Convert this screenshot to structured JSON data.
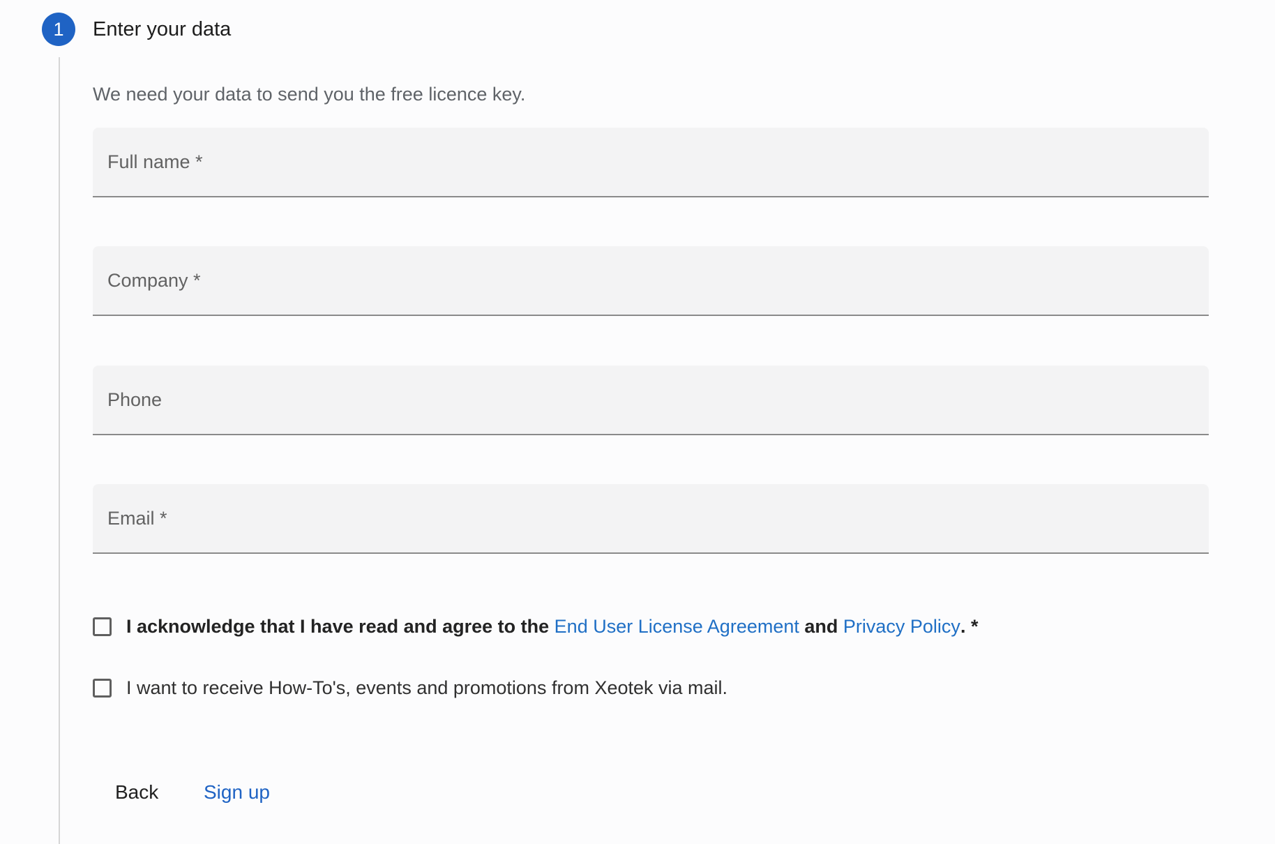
{
  "step": {
    "number": "1",
    "title": "Enter your data"
  },
  "subtitle": "We need your data to send you the free licence key.",
  "fields": {
    "full_name": {
      "placeholder": "Full name *",
      "value": ""
    },
    "company": {
      "placeholder": "Company *",
      "value": ""
    },
    "phone": {
      "placeholder": "Phone",
      "value": ""
    },
    "email": {
      "placeholder": "Email *",
      "value": ""
    }
  },
  "consent": {
    "ack_prefix": "I acknowledge that I have read and agree to the ",
    "eula_link": "End User License Agreement",
    "ack_and": " and ",
    "privacy_link": "Privacy Policy",
    "ack_suffix": ". *",
    "ack_checked": false,
    "newsletter_text": "I want to receive How-To's, events and promotions from Xeotek via mail.",
    "newsletter_checked": false
  },
  "actions": {
    "back_label": "Back",
    "signup_label": "Sign up"
  },
  "colors": {
    "accent": "#1f63c4",
    "link": "#1f6fc5",
    "field_bg": "#f3f3f4"
  }
}
